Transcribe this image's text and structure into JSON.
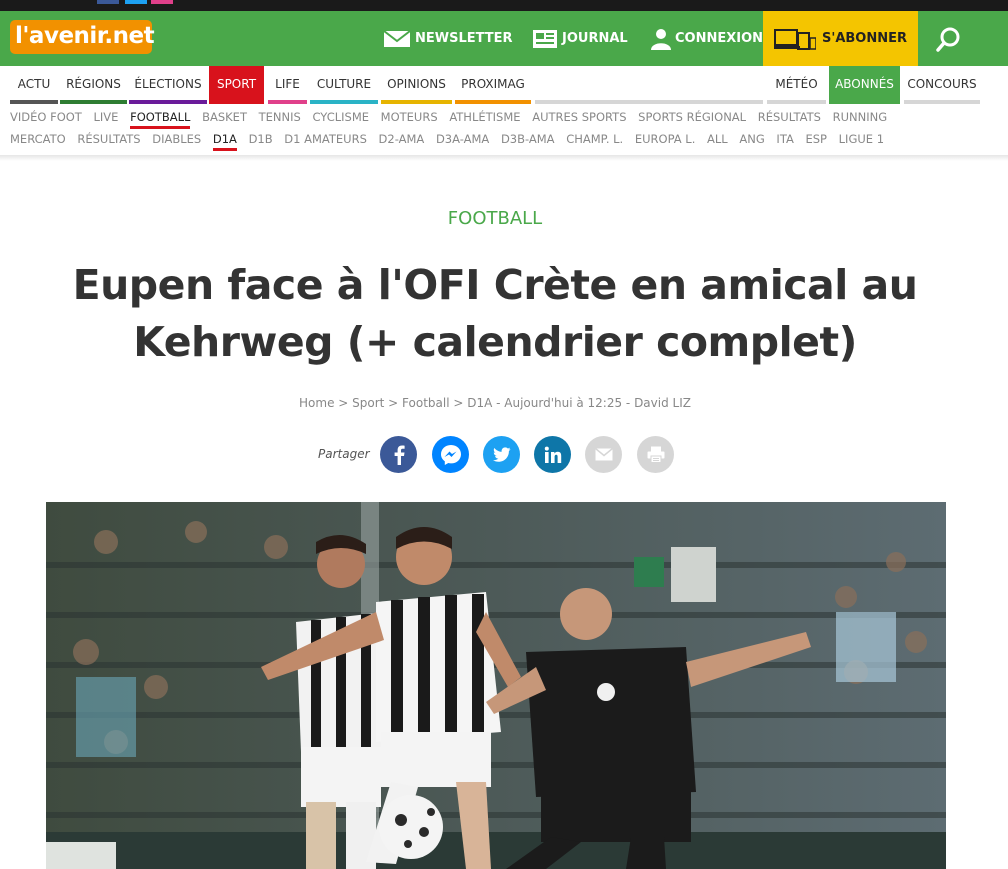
{
  "colors": {
    "green": "#4aa84a",
    "orange": "#f29100",
    "yellow": "#f4c500",
    "red": "#d8121c"
  },
  "header": {
    "logo_text": "l'avenir",
    "logo_suffix": ".net",
    "newsletter": "NEWSLETTER",
    "journal": "JOURNAL",
    "connexion": "CONNEXION",
    "abonner": "S'ABONNER"
  },
  "mainnav": {
    "items": [
      {
        "label": "ACTU",
        "color": "#555555"
      },
      {
        "label": "RÉGIONS",
        "color": "#2e7d32"
      },
      {
        "label": "ÉLECTIONS",
        "color": "#6a1b9a"
      },
      {
        "label": "SPORT",
        "color": "#d8121c"
      },
      {
        "label": "LIFE",
        "color": "#e0408a"
      },
      {
        "label": "CULTURE",
        "color": "#2ab3c6"
      },
      {
        "label": "OPINIONS",
        "color": "#e6b400"
      },
      {
        "label": "PROXIMAG",
        "color": "#f29100"
      },
      {
        "label": "MÉTÉO",
        "color": "#cccccc"
      },
      {
        "label": "ABONNÉS",
        "color": "#4aa84a"
      },
      {
        "label": "CONCOURS",
        "color": "#cccccc"
      }
    ]
  },
  "subnav1": [
    "VIDÉO FOOT",
    "LIVE",
    "FOOTBALL",
    "BASKET",
    "TENNIS",
    "CYCLISME",
    "MOTEURS",
    "ATHLÉTISME",
    "AUTRES SPORTS",
    "SPORTS RÉGIONAL",
    "RÉSULTATS",
    "RUNNING"
  ],
  "subnav2": [
    "MERCATO",
    "RÉSULTATS",
    "DIABLES",
    "D1A",
    "D1B",
    "D1 AMATEURS",
    "D2-AMA",
    "D3A-AMA",
    "D3B-AMA",
    "CHAMP. L.",
    "EUROPA L.",
    "ALL",
    "ANG",
    "ITA",
    "ESP",
    "LIGUE 1"
  ],
  "article": {
    "category": "FOOTBALL",
    "title_line1": "Eupen face à l'OFI Crète en amical au",
    "title_line2": "Kehrweg (+ calendrier complet)",
    "meta": "Home > Sport > Football > D1A - Aujourd'hui à 12:25 - David LIZ",
    "share_label": "Partager"
  },
  "share_buttons": [
    {
      "icon": "facebook-icon",
      "color": "#3b5998"
    },
    {
      "icon": "messenger-icon",
      "color": "#0084ff"
    },
    {
      "icon": "twitter-icon",
      "color": "#1da1f2"
    },
    {
      "icon": "linkedin-icon",
      "color": "#0e76a8"
    },
    {
      "icon": "email-icon",
      "color": "#cccccc"
    },
    {
      "icon": "print-icon",
      "color": "#cccccc"
    }
  ]
}
